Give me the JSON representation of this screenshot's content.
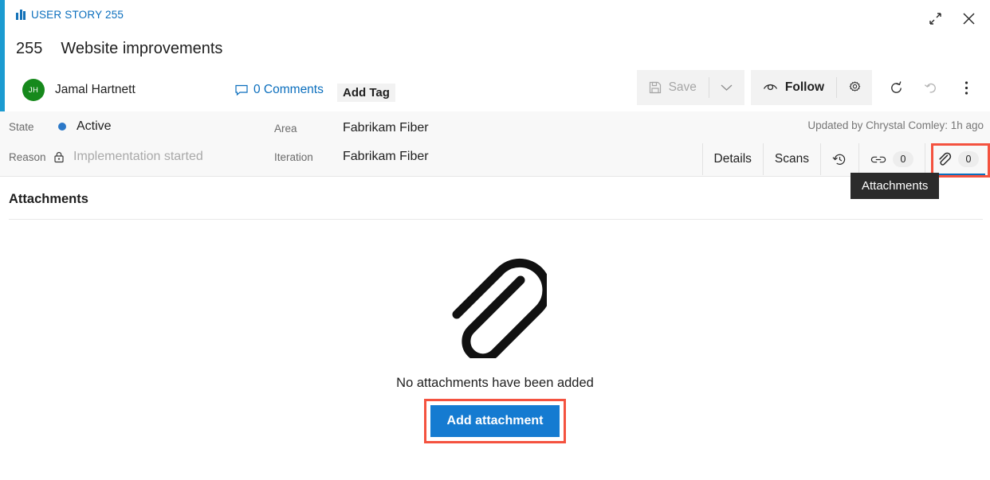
{
  "window": {
    "restore_icon": "restore-icon",
    "close_icon": "close-icon"
  },
  "header": {
    "breadcrumb": "USER STORY 255",
    "breadcrumb_icon": "work-item-icon",
    "work_item_id": "255",
    "work_item_title": "Website improvements",
    "assignee": {
      "initials": "JH",
      "name": "Jamal Hartnett"
    },
    "comments_label": "0 Comments",
    "comments_icon": "comment-icon",
    "add_tag_label": "Add Tag"
  },
  "toolbar": {
    "save_label": "Save",
    "save_icon": "save-icon",
    "save_dropdown_icon": "chevron-down-icon",
    "follow_label": "Follow",
    "follow_icon": "eye-icon",
    "settings_icon": "gear-icon",
    "refresh_icon": "refresh-icon",
    "revert_icon": "undo-icon",
    "more_icon": "kebab-menu-icon"
  },
  "info": {
    "state_label": "State",
    "state_value": "Active",
    "state_color": "#2b78c8",
    "reason_label": "Reason",
    "reason_value": "Implementation started",
    "reason_icon": "lock-icon",
    "area_label": "Area",
    "area_value": "Fabrikam Fiber",
    "iteration_label": "Iteration",
    "iteration_value": "Fabrikam Fiber",
    "updated_note": "Updated by Chrystal Comley: 1h ago"
  },
  "tabs": [
    {
      "label": "Details",
      "icon": "",
      "count": "",
      "active": false
    },
    {
      "label": "Scans",
      "icon": "",
      "count": "",
      "active": false
    },
    {
      "label": "",
      "icon": "history-icon",
      "count": "",
      "active": false
    },
    {
      "label": "",
      "icon": "link-icon",
      "count": "0",
      "active": false
    },
    {
      "label": "",
      "icon": "paperclip-icon",
      "count": "0",
      "active": true
    }
  ],
  "tooltip": {
    "text": "Attachments"
  },
  "content": {
    "section_title": "Attachments",
    "illustration_icon": "paperclip-illustration",
    "empty_message": "No attachments have been added",
    "add_attachment_label": "Add attachment"
  },
  "accents": {
    "highlight_color": "#f4523f",
    "primary_blue": "#157bd1",
    "bar_blue": "#1b9bd1",
    "avatar_green": "#16891c"
  }
}
